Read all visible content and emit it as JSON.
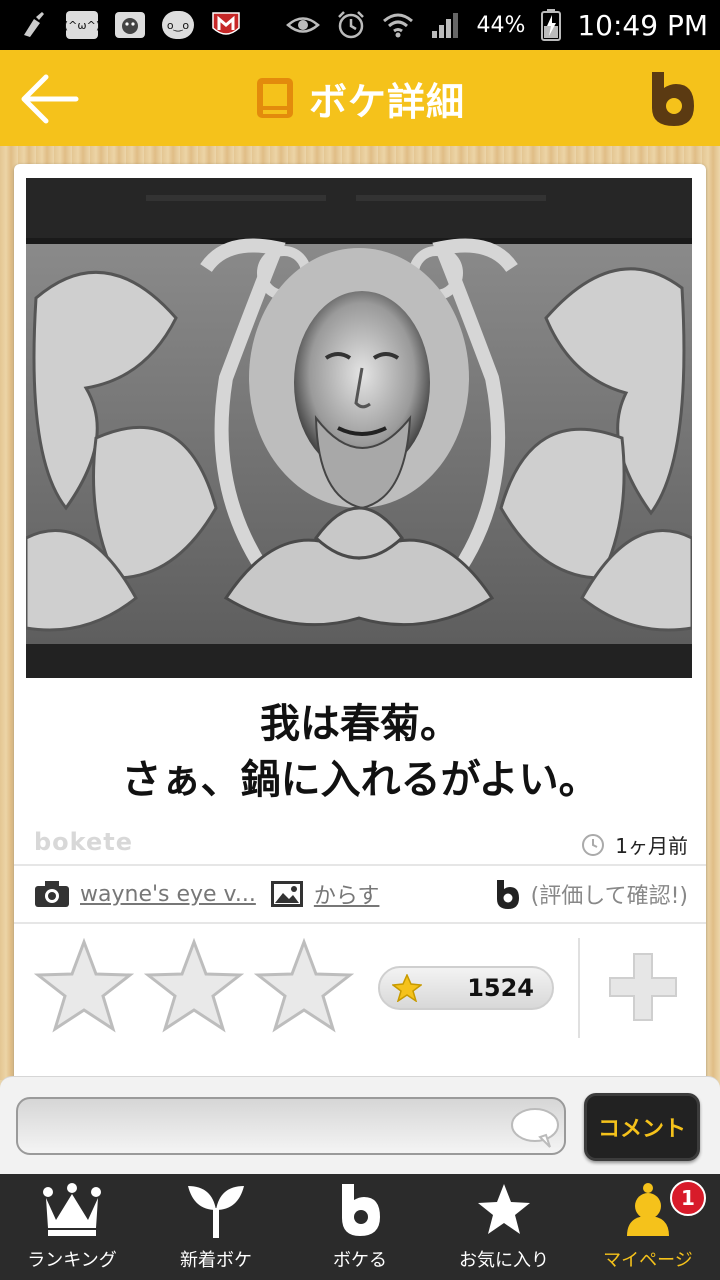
{
  "status_bar": {
    "notif_icons": [
      "broom-icon",
      "kaomoji-icon",
      "dog-icon",
      "kaomoji2-icon",
      "mcafee-icon"
    ],
    "kaomoji_1": "(^ω^)",
    "kaomoji_2": "o‿o",
    "battery": "44%",
    "time": "10:49 PM"
  },
  "header": {
    "title": "ボケ詳細"
  },
  "post": {
    "caption": "我は春菊。\nさぁ、鍋に入れるがよい。",
    "watermark": "bokete",
    "time_ago": "1ヶ月前",
    "photo_credit": "wayne's eye v...",
    "odai_author": "からす",
    "evaluation_hint": "(評価して確認!)",
    "star_count": "1524"
  },
  "comment": {
    "placeholder": "",
    "submit_label": "コメント"
  },
  "nav": {
    "items": [
      {
        "label": "ランキング"
      },
      {
        "label": "新着ボケ"
      },
      {
        "label": "ボケる"
      },
      {
        "label": "お気に入り"
      },
      {
        "label": "マイページ"
      }
    ],
    "badge": "1"
  },
  "colors": {
    "accent": "#f5c21b",
    "nav_bg": "#2b2b2b",
    "badge": "#d81b2a"
  }
}
